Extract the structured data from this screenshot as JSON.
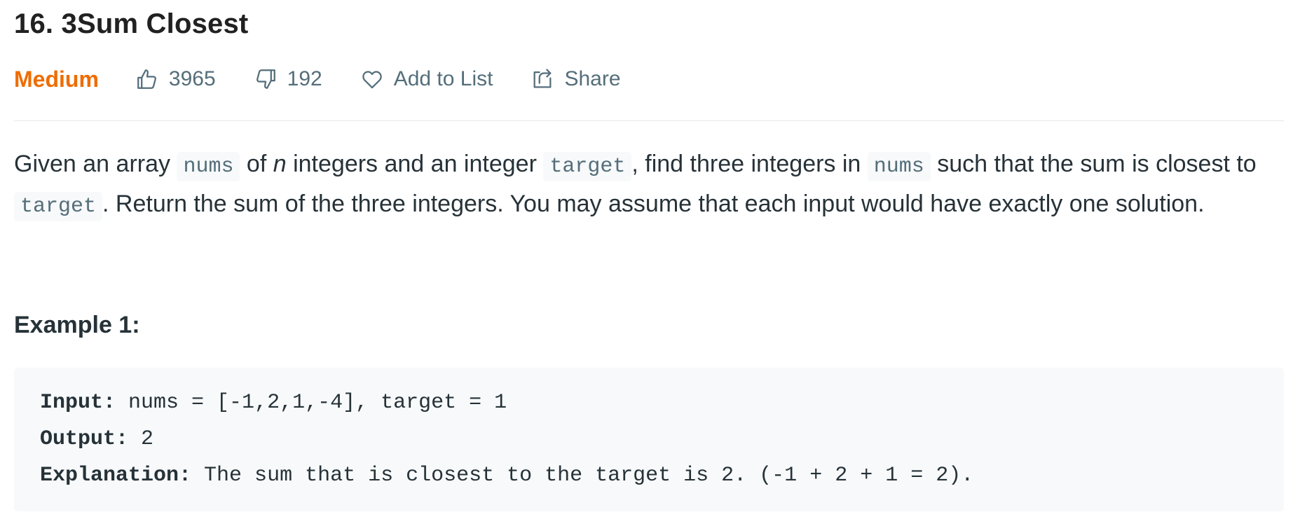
{
  "problem": {
    "title": "16. 3Sum Closest",
    "difficulty": "Medium",
    "likes": "3965",
    "dislikes": "192",
    "add_to_list_label": "Add to List",
    "share_label": "Share"
  },
  "description": {
    "text1": "Given an array ",
    "code_nums_1": "nums",
    "text2": " of ",
    "var_n": "n",
    "text3": " integers and an integer ",
    "code_target_1": "target",
    "text4": ", find three integers in ",
    "code_nums_2": "nums",
    "text5": " such that the sum is closest to ",
    "code_target_2": "target",
    "text6": ". Return the sum of the three integers. You may assume that each input would have exactly one solution."
  },
  "example1": {
    "heading": "Example 1:",
    "input_label": "Input:",
    "input_value": " nums = [-1,2,1,-4], target = 1",
    "output_label": "Output:",
    "output_value": " 2",
    "explanation_label": "Explanation:",
    "explanation_value": " The sum that is closest to the target is 2. (-1 + 2 + 1 = 2)."
  },
  "colors": {
    "difficulty_medium": "#ef6c00",
    "meta_text": "#546e7a",
    "code_background": "#f7f9fa"
  },
  "icons": {
    "like": "thumbs-up-icon",
    "dislike": "thumbs-down-icon",
    "add_to_list": "heart-icon",
    "share": "share-icon"
  }
}
